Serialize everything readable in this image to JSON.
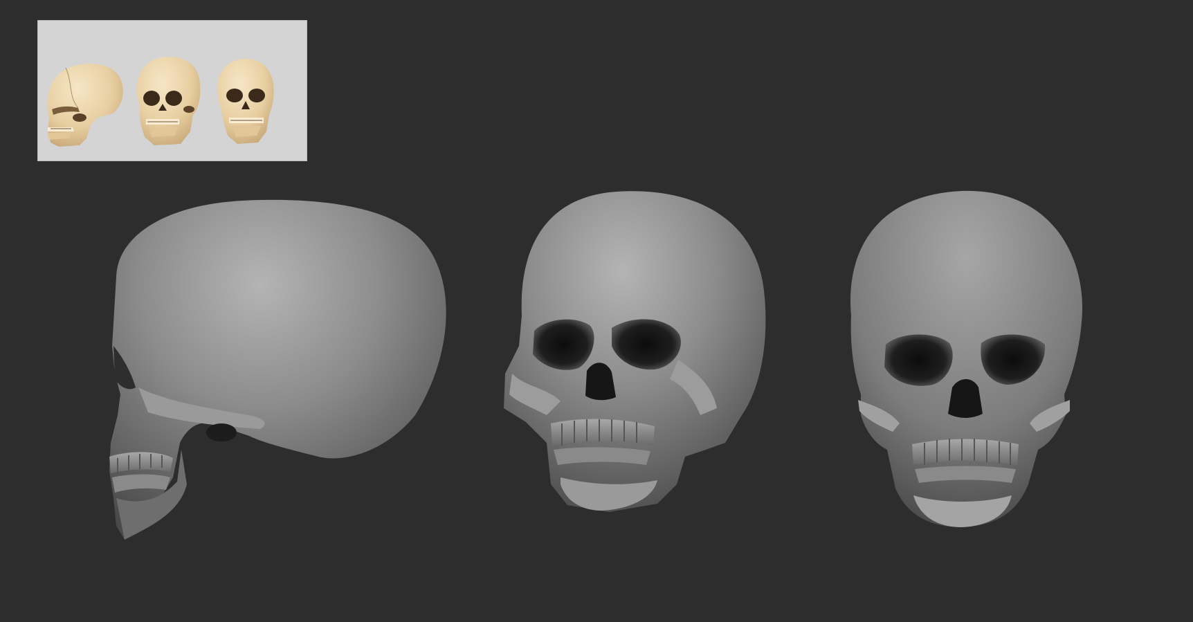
{
  "viewport": {
    "background_color": "#2d2d2d"
  },
  "reference_panel": {
    "background_color": "#d4d4d4",
    "bone_color": "#ecd6ae",
    "views": [
      "side-view",
      "three-quarter-view",
      "front-view"
    ]
  },
  "sculpts": {
    "clay_color": "#8a8a8a",
    "views": [
      "side-view",
      "three-quarter-view",
      "front-view"
    ]
  }
}
